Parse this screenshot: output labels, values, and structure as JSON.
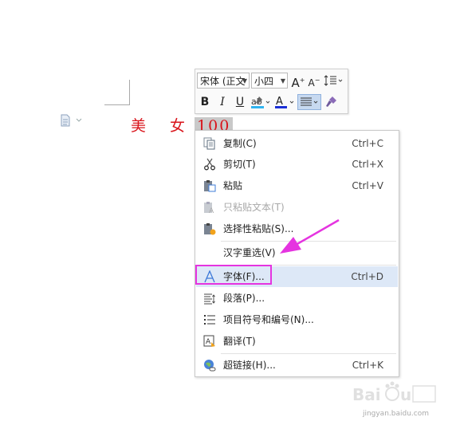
{
  "document": {
    "text_plain": "美 女",
    "text_selected": "100"
  },
  "mini_toolbar": {
    "font_name": "宋体 (正文",
    "font_size": "小四",
    "grow_label": "A",
    "shrink_label": "A",
    "bold_label": "B",
    "italic_label": "I",
    "underline_label": "U",
    "font_color_label": "A"
  },
  "context_menu": {
    "items": [
      {
        "label": "复制(C)",
        "shortcut": "Ctrl+C"
      },
      {
        "label": "剪切(T)",
        "shortcut": "Ctrl+X"
      },
      {
        "label": "粘贴",
        "shortcut": "Ctrl+V"
      },
      {
        "label": "只粘贴文本(T)",
        "shortcut": ""
      },
      {
        "label": "选择性粘贴(S)...",
        "shortcut": ""
      },
      {
        "label": "汉字重选(V)",
        "shortcut": ""
      },
      {
        "label": "字体(F)...",
        "shortcut": "Ctrl+D"
      },
      {
        "label": "段落(P)...",
        "shortcut": ""
      },
      {
        "label": "项目符号和编号(N)...",
        "shortcut": ""
      },
      {
        "label": "翻译(T)",
        "shortcut": ""
      },
      {
        "label": "超链接(H)...",
        "shortcut": "Ctrl+K"
      }
    ]
  },
  "colors": {
    "doc_text": "#d9141b",
    "highlight_box": "#e534e0",
    "arrow": "#e534e0",
    "menu_hover": "#dde8f7"
  },
  "watermark": {
    "url": "jingyan.baidu.com"
  }
}
